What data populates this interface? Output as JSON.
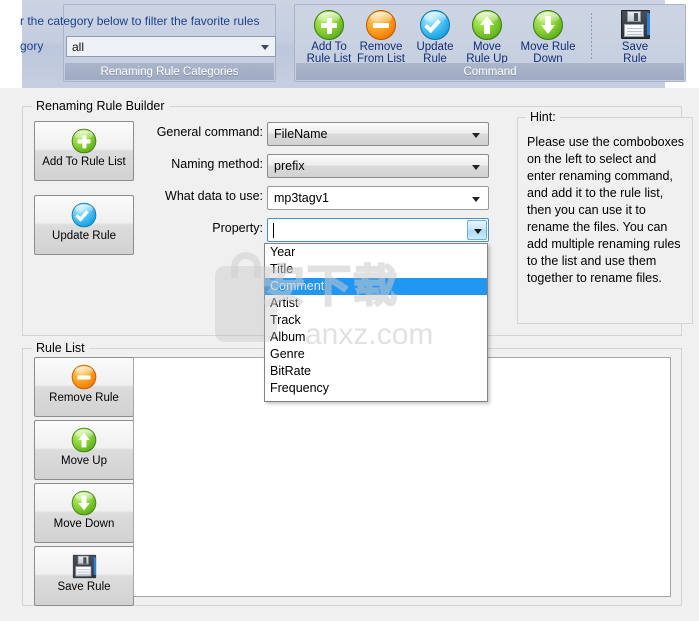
{
  "ribbon": {
    "categories_group": {
      "title": "Renaming Rule Categories",
      "description": "r the category below to filter the favorite rules",
      "label": "gory",
      "combo_value": "all",
      "arrow_icon": "chevron-down-icon"
    },
    "command_group": {
      "title": "Command",
      "buttons": [
        {
          "label": "Add To\nRule List",
          "line1": "Add To",
          "line2": "Rule List",
          "icon": "plus-circle-icon",
          "color": "#8dd43a"
        },
        {
          "label": "Remove\nFrom List",
          "line1": "Remove",
          "line2": "From List",
          "icon": "minus-circle-icon",
          "color": "#ffa524"
        },
        {
          "label": "Update\nRule",
          "line1": "Update",
          "line2": "Rule",
          "icon": "check-circle-icon",
          "color": "#4fc4f5"
        },
        {
          "label": "Move\nRule Up",
          "line1": "Move",
          "line2": "Rule Up",
          "icon": "arrow-up-circle-icon",
          "color": "#8dd43a"
        },
        {
          "label": "Move Rule\nDown",
          "line1": "Move Rule",
          "line2": "Down",
          "icon": "arrow-down-circle-icon",
          "color": "#8dd43a"
        },
        {
          "label": "Save\nRule",
          "line1": "Save",
          "line2": "Rule",
          "icon": "floppy-disk-icon",
          "color": "#2f343b"
        }
      ]
    }
  },
  "builder": {
    "title": "Renaming Rule Builder",
    "buttons": [
      {
        "label": "Add To Rule List",
        "icon": "plus-circle-icon"
      },
      {
        "label": "Update Rule",
        "icon": "check-circle-icon"
      }
    ],
    "fields": [
      {
        "label": "General command:",
        "value": "FileName",
        "style": "grey"
      },
      {
        "label": "Naming method:",
        "value": "prefix",
        "style": "grey"
      },
      {
        "label": "What data to use:",
        "value": "mp3tagv1",
        "style": "white"
      },
      {
        "label": "Property:",
        "value": "",
        "style": "focused"
      }
    ]
  },
  "property_dropdown": {
    "options": [
      "Year",
      "Title",
      "Comment",
      "Artist",
      "Track",
      "Album",
      "Genre",
      "BitRate",
      "Frequency"
    ],
    "selected": "Comment",
    "selected_index": 2,
    "highlight_color": "#2196f3"
  },
  "hint": {
    "title": "Hint:",
    "text": "Please use the comboboxes on the left to select and enter renaming command, and add it to the rule list, then you can use it to rename the files. You can add multiple renaming rules to the list and use them together to rename files."
  },
  "rule_list": {
    "title": "Rule List",
    "buttons": [
      {
        "label": "Remove Rule",
        "icon": "minus-circle-icon"
      },
      {
        "label": "Move Up",
        "icon": "arrow-up-circle-icon"
      },
      {
        "label": "Move Down",
        "icon": "arrow-down-circle-icon"
      },
      {
        "label": "Save Rule",
        "icon": "floppy-disk-icon"
      }
    ],
    "items": []
  },
  "watermark": {
    "chinese": "安下载",
    "url": "anxz.com"
  }
}
